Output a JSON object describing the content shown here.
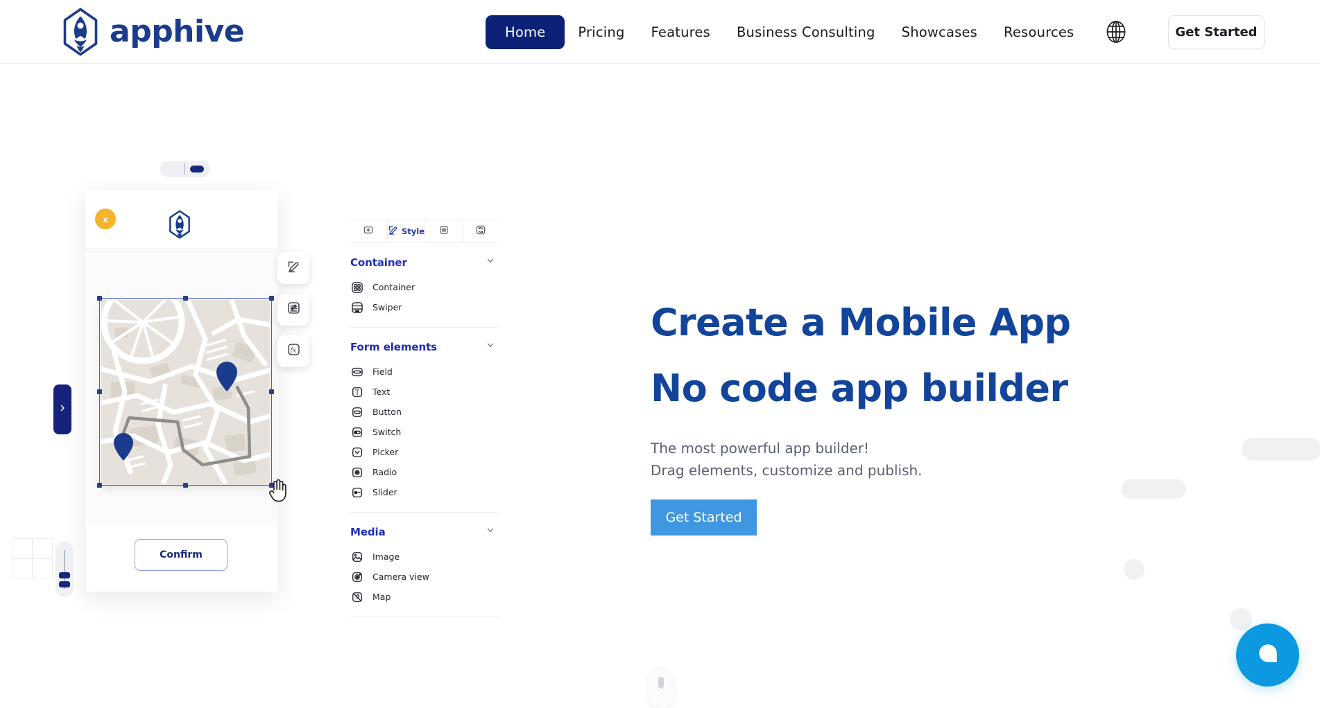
{
  "brand": {
    "name": "apphive",
    "logo_icon": "rocket-hexagon-logo",
    "primary_navy": "#0b2277",
    "headline_blue": "#11449a",
    "accent_blue": "#3e97e0",
    "chat_blue": "#0d99e0",
    "warning_yellow": "#f7b32b"
  },
  "header": {
    "nav_items": [
      {
        "label": "Home",
        "active": true
      },
      {
        "label": "Pricing",
        "active": false
      },
      {
        "label": "Features",
        "active": false
      },
      {
        "label": "Business Consulting",
        "active": false
      },
      {
        "label": "Showcases",
        "active": false
      },
      {
        "label": "Resources",
        "active": false
      }
    ],
    "language_icon": "globe-icon",
    "cta_label": "Get Started"
  },
  "hero": {
    "title_line1": "Create a Mobile App",
    "title_line2": "No code app builder",
    "subtitle_line1": "The most powerful app builder!",
    "subtitle_line2": "Drag elements, customize and publish.",
    "cta_label": "Get Started"
  },
  "builder": {
    "phone": {
      "close_label": "x",
      "app_logo_icon": "rocket-hexagon-logo",
      "selected_element": "map-widget",
      "map": {
        "pin_count": 2,
        "pins": [
          "origin-pin",
          "destination-pin"
        ],
        "route": "walking-route"
      }
    },
    "side_tab_icon": "chevron-right-icon",
    "float_tools": [
      {
        "icon": "edit-pencil-icon",
        "name": "edit-tool"
      },
      {
        "icon": "sliders-settings-icon",
        "name": "properties-tool"
      },
      {
        "icon": "function-fx-icon",
        "name": "logic-tool"
      }
    ],
    "cursor_icon": "pointer-hand-cursor",
    "confirm_label": "Confirm",
    "grid_icon": "grid-2x2-icon",
    "slider_name": "vertical-slider"
  },
  "panel": {
    "tabs": [
      {
        "label": "",
        "icon": "plus-square-icon",
        "active": false
      },
      {
        "label": "Style",
        "icon": "edit-pencil-icon",
        "active": true
      },
      {
        "label": "",
        "icon": "list-lines-icon",
        "active": false
      },
      {
        "label": "",
        "icon": "refresh-sync-icon",
        "active": false
      }
    ],
    "sections": [
      {
        "title": "Container",
        "collapse_icon": "chevron-down-icon",
        "items": [
          {
            "label": "Container",
            "icon": "grid-four-squares-icon"
          },
          {
            "label": "Swiper",
            "icon": "swiper-rows-icon"
          }
        ]
      },
      {
        "title": "Form elements",
        "collapse_icon": "chevron-down-icon",
        "items": [
          {
            "label": "Field",
            "icon": "input-field-icon"
          },
          {
            "label": "Text",
            "icon": "text-t-icon"
          },
          {
            "label": "Button",
            "icon": "button-pill-icon"
          },
          {
            "label": "Switch",
            "icon": "switch-toggle-icon"
          },
          {
            "label": "Picker",
            "icon": "chevron-down-box-icon"
          },
          {
            "label": "Radio",
            "icon": "radio-dot-icon"
          },
          {
            "label": "Slider",
            "icon": "slider-handle-icon"
          }
        ]
      },
      {
        "title": "Media",
        "collapse_icon": "chevron-down-icon",
        "items": [
          {
            "label": "Image",
            "icon": "image-mountain-icon"
          },
          {
            "label": "Camera view",
            "icon": "camera-lens-icon"
          },
          {
            "label": "Map",
            "icon": "map-pin-box-icon"
          }
        ]
      }
    ]
  },
  "chat": {
    "icon": "chat-bubble-icon"
  },
  "scroll_hint": {
    "icon": "scroll-mouse-icon"
  }
}
